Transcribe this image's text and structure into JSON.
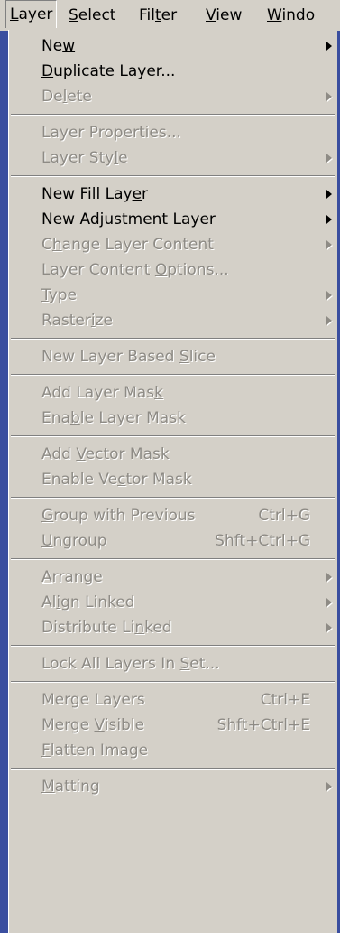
{
  "menubar": {
    "items": [
      {
        "label": "Layer",
        "mnemonic": "L"
      },
      {
        "label": "Select",
        "mnemonic": "S"
      },
      {
        "label": "Filter",
        "mnemonic": "t"
      },
      {
        "label": "View",
        "mnemonic": "V"
      },
      {
        "label": "Windo",
        "mnemonic": "W"
      }
    ]
  },
  "menu": {
    "groups": [
      [
        {
          "label": "New",
          "mn": 2,
          "enabled": true,
          "submenu": true
        },
        {
          "label": "Duplicate Layer...",
          "mn": 0,
          "enabled": true,
          "submenu": false
        },
        {
          "label": "Delete",
          "mn": 2,
          "enabled": false,
          "submenu": true
        }
      ],
      [
        {
          "label": "Layer Properties...",
          "mn": -1,
          "enabled": false,
          "submenu": false
        },
        {
          "label": "Layer Style",
          "mn": 9,
          "enabled": false,
          "submenu": true
        }
      ],
      [
        {
          "label": "New Fill Layer",
          "mn": 12,
          "enabled": true,
          "submenu": true
        },
        {
          "label": "New Adjustment Layer",
          "mn": 6,
          "enabled": true,
          "submenu": true
        },
        {
          "label": "Change Layer Content",
          "mn": 1,
          "enabled": false,
          "submenu": true
        },
        {
          "label": "Layer Content Options...",
          "mn": 14,
          "enabled": false,
          "submenu": false
        },
        {
          "label": "Type",
          "mn": 0,
          "enabled": false,
          "submenu": true
        },
        {
          "label": "Rasterize",
          "mn": 6,
          "enabled": false,
          "submenu": true
        }
      ],
      [
        {
          "label": "New Layer Based Slice",
          "mn": 16,
          "enabled": false,
          "submenu": false
        }
      ],
      [
        {
          "label": "Add Layer Mask",
          "mn": 13,
          "enabled": false,
          "submenu": false
        },
        {
          "label": "Enable Layer Mask",
          "mn": 3,
          "enabled": false,
          "submenu": false
        }
      ],
      [
        {
          "label": "Add Vector Mask",
          "mn": 4,
          "enabled": false,
          "submenu": false
        },
        {
          "label": "Enable Vector Mask",
          "mn": 9,
          "enabled": false,
          "submenu": false
        }
      ],
      [
        {
          "label": "Group with Previous",
          "mn": 0,
          "enabled": false,
          "submenu": false,
          "shortcut": "Ctrl+G"
        },
        {
          "label": "Ungroup",
          "mn": 0,
          "enabled": false,
          "submenu": false,
          "shortcut": "Shft+Ctrl+G"
        }
      ],
      [
        {
          "label": "Arrange",
          "mn": 0,
          "enabled": false,
          "submenu": true
        },
        {
          "label": "Align Linked",
          "mn": 2,
          "enabled": false,
          "submenu": true
        },
        {
          "label": "Distribute Linked",
          "mn": 13,
          "enabled": false,
          "submenu": true
        }
      ],
      [
        {
          "label": "Lock All Layers In Set...",
          "mn": 19,
          "enabled": false,
          "submenu": false
        }
      ],
      [
        {
          "label": "Merge Layers",
          "mn": -1,
          "enabled": false,
          "submenu": false,
          "shortcut": "Ctrl+E"
        },
        {
          "label": "Merge Visible",
          "mn": 6,
          "enabled": false,
          "submenu": false,
          "shortcut": "Shft+Ctrl+E"
        },
        {
          "label": "Flatten Image",
          "mn": 0,
          "enabled": false,
          "submenu": false
        }
      ],
      [
        {
          "label": "Matting",
          "mn": 0,
          "enabled": false,
          "submenu": true
        }
      ]
    ]
  }
}
